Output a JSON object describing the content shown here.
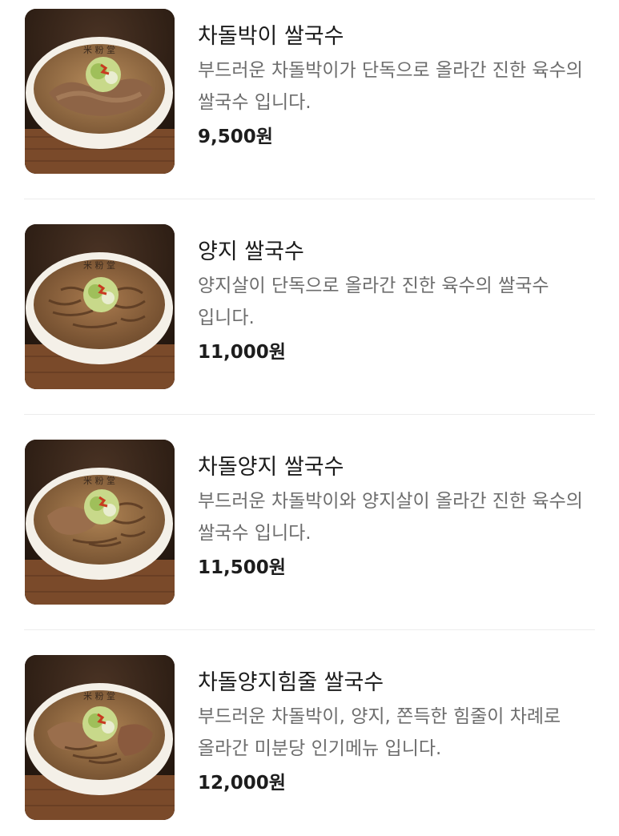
{
  "menu": {
    "items": [
      {
        "name": "차돌박이 쌀국수",
        "description": "부드러운 차돌박이가 단독으로 올라간 진한 육수의 쌀국수 입니다.",
        "price": "9,500원",
        "bowl_brand": "米粉堂",
        "topping": "brisket"
      },
      {
        "name": "양지 쌀국수",
        "description": "양지살이 단독으로 올라간 진한 육수의 쌀국수 입니다.",
        "price": "11,000원",
        "bowl_brand": "米粉堂",
        "topping": "flank"
      },
      {
        "name": "차돌양지 쌀국수",
        "description": "부드러운 차돌박이와 양지살이 올라간 진한 육수의 쌀국수 입니다.",
        "price": "11,500원",
        "bowl_brand": "米粉堂",
        "topping": "brisket-flank"
      },
      {
        "name": "차돌양지힘줄 쌀국수",
        "description": "부드러운 차돌박이, 양지, 쫀득한 힘줄이 차례로 올라간 미분당 인기메뉴 입니다.",
        "price": "12,000원",
        "bowl_brand": "米粉堂",
        "topping": "brisket-flank-tendon"
      }
    ]
  },
  "colors": {
    "title": "#1b1b1b",
    "description": "#6d6d6d",
    "price": "#1d1d1d",
    "divider": "#ececec"
  }
}
